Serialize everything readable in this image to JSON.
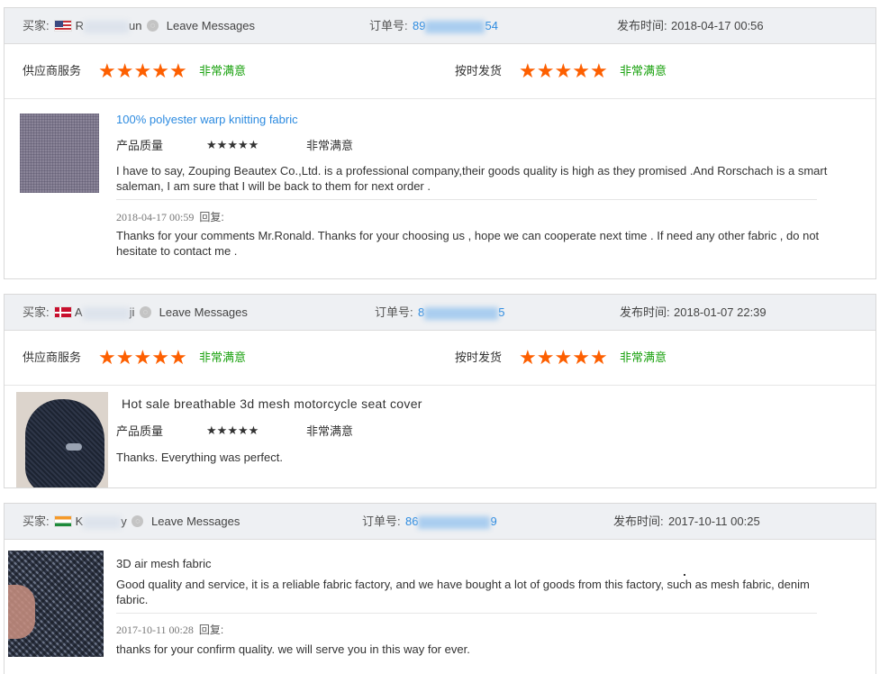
{
  "labels": {
    "buyer": "买家:",
    "leave_messages": "Leave Messages",
    "order_no": "订单号:",
    "published": "发布时间:",
    "supplier_service": "供应商服务",
    "on_time_shipping": "按时发货",
    "product_quality": "产品质量",
    "satisfied": "非常满意",
    "reply": "回复:"
  },
  "star": "★",
  "reviews": [
    {
      "buyer_flag": "US",
      "buyer_name_start": "R",
      "buyer_name_end": "un",
      "order_start": "89",
      "order_end": "54",
      "published_time": "2018-04-17 00:56",
      "supplier_service_stars": 5,
      "on_time_stars": 5,
      "product_title": "100% polyester warp knitting fabric",
      "product_image": "gray-knit-fabric",
      "quality_stars": 5,
      "comment": "I have to say, Zouping Beautex Co.,Ltd. is a professional company,their goods quality is high as they promised .And Rorschach is a smart saleman, I am sure that I will be back to them for next order .",
      "reply_time": "2018-04-17 00:59",
      "reply_text": "Thanks for your comments Mr.Ronald. Thanks for your choosing us , hope we can cooperate next time . If need any other fabric , do not hesitate to contact me ."
    },
    {
      "buyer_flag": "DK",
      "buyer_name_start": "A",
      "buyer_name_end": "ji",
      "order_start": "8",
      "order_end": "5",
      "published_time": "2018-01-07 22:39",
      "supplier_service_stars": 5,
      "on_time_stars": 5,
      "product_title": "Hot sale breathable 3d mesh motorcycle seat cover",
      "product_image": "mesh-seat-cover",
      "quality_stars": 5,
      "comment": "Thanks. Everything was perfect."
    },
    {
      "buyer_flag": "IN",
      "buyer_name_start": "K",
      "buyer_name_end": "y",
      "order_start": "86",
      "order_end": "9",
      "published_time": "2017-10-11 00:25",
      "product_title": "3D air mesh fabric",
      "product_image": "3d-air-mesh",
      "comment": "Good quality and service, it is a reliable fabric factory, and we have bought a lot of goods from this factory, such as mesh fabric, denim fabric.",
      "reply_time": "2017-10-11 00:28",
      "reply_text": "thanks for your confirm quality. we will serve you in this way for ever."
    }
  ]
}
